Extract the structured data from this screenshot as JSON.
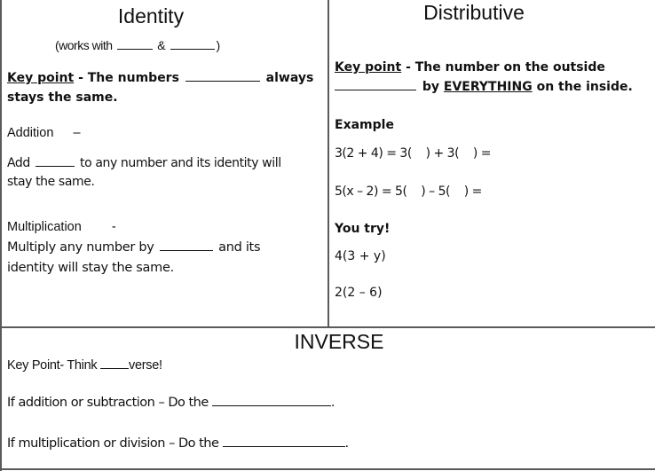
{
  "identity": {
    "title": "Identity",
    "works_with_prefix": "(works with",
    "works_with_amp": "&",
    "works_with_suffix": ")",
    "key_point_label": "Key point",
    "key_point_text_before": " - The numbers ",
    "key_point_text_after": " always",
    "key_point_line2": "stays the same.",
    "addition_heading": "Addition",
    "addition_dash": "–",
    "addition_text_before": "Add ",
    "addition_text_after": " to any number and its identity will",
    "addition_line2": "stay the same.",
    "multiplication_heading": "Multiplication",
    "multiplication_dash": "-",
    "multiplication_text_before": "Multiply any number by ",
    "multiplication_text_after": " and its",
    "multiplication_line2": "identity will stay the same."
  },
  "distributive": {
    "title": "Distributive",
    "key_point_label": "Key point",
    "key_point_text": " - The number on the outside",
    "key_point_line2_mid": " by ",
    "key_point_emphasis": "EVERYTHING",
    "key_point_line2_end": " on the inside.",
    "example_heading": "Example",
    "example_1": "3(2 + 4) = 3(    ) + 3(    ) =",
    "example_2": "5(x – 2) = 5(    ) – 5(    ) =",
    "you_try_heading": "You try!",
    "you_try_1": "4(3 + y)",
    "you_try_2": "2(2 – 6)"
  },
  "inverse": {
    "title": "INVERSE",
    "key_point_before": "Key Point- Think ",
    "key_point_after": "verse!",
    "line_addition": "If addition or subtraction – Do the ",
    "line_multiplication": "If multiplication or division – Do the ",
    "period": "."
  }
}
